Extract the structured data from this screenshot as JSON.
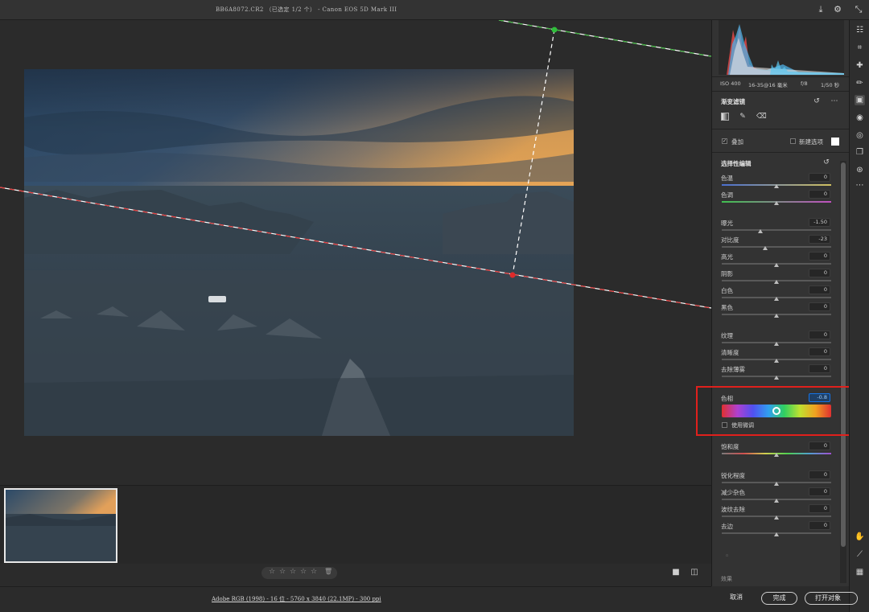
{
  "window": {
    "title": "BB6A8072.CR2 （已选定 1/2 个） - Canon EOS 5D Mark III"
  },
  "exif": {
    "iso": "ISO 400",
    "lens": "16-35@16 毫米",
    "aperture": "f/8",
    "shutter": "1/50 秒"
  },
  "gradient_filter": {
    "title": "渐变滤镜",
    "overlay_label": "叠加",
    "create_new_label": "新建选项"
  },
  "selective_edit": {
    "title": "选择性编辑",
    "sliders": [
      {
        "label": "色温",
        "value": "0",
        "pos": 0.5
      },
      {
        "label": "色调",
        "value": "0",
        "pos": 0.5
      },
      {
        "label": "曝光",
        "value": "-1.50",
        "pos": 0.35
      },
      {
        "label": "对比度",
        "value": "-23",
        "pos": 0.4
      },
      {
        "label": "高光",
        "value": "0",
        "pos": 0.5
      },
      {
        "label": "阴影",
        "value": "0",
        "pos": 0.5
      },
      {
        "label": "白色",
        "value": "0",
        "pos": 0.5
      },
      {
        "label": "黑色",
        "value": "0",
        "pos": 0.5
      },
      {
        "label": "纹理",
        "value": "0",
        "pos": 0.5
      },
      {
        "label": "清晰度",
        "value": "0",
        "pos": 0.5
      },
      {
        "label": "去除薄雾",
        "value": "0",
        "pos": 0.5
      }
    ],
    "hue": {
      "label": "色相",
      "value": "-0.8",
      "fine_adjust_label": "使用微调",
      "pos": 0.5
    },
    "saturation": {
      "label": "饱和度",
      "value": "0",
      "pos": 0.5
    },
    "detail_sliders": [
      {
        "label": "锐化程度",
        "value": "0",
        "pos": 0.5
      },
      {
        "label": "减少杂色",
        "value": "0",
        "pos": 0.5
      },
      {
        "label": "波纹去除",
        "value": "0",
        "pos": 0.5
      },
      {
        "label": "去边",
        "value": "0",
        "pos": 0.5
      }
    ],
    "bottom_label": "效果"
  },
  "footer": {
    "info": "Adobe RGB (1998) - 16 位 - 5760 x 3840 (22.1MP) - 300 ppi",
    "cancel": "取消",
    "done": "完成",
    "open": "打开对象"
  },
  "rating": {
    "stars": [
      "☆",
      "☆",
      "☆",
      "☆",
      "☆"
    ],
    "trash": "🗑"
  },
  "icons": [
    "save-icon",
    "gear-icon",
    "collapse-icon",
    "edit-icon",
    "crop-icon",
    "healing-icon",
    "brush-icon",
    "linear-gradient-icon",
    "radial-gradient-icon",
    "red-eye-icon",
    "snapshots-icon",
    "presets-icon",
    "more-icon",
    "hand-icon",
    "eyedropper-icon",
    "grid-icon"
  ],
  "colors": {
    "panel_bg": "#333333",
    "accent": "#1473e6",
    "highlight_box": "#e0201c"
  }
}
